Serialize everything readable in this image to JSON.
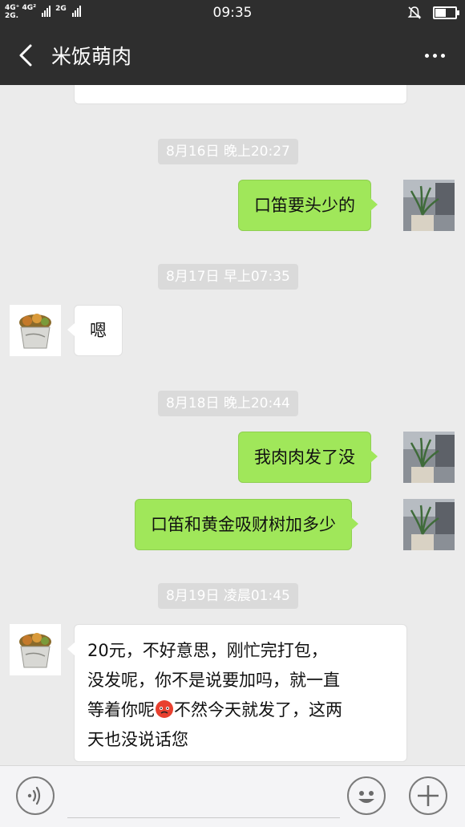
{
  "status_bar": {
    "network_top": "4G⁺ 4G²",
    "network_bottom": "2G.",
    "network_third": "2G",
    "time": "09:35",
    "battery_level": 0.6,
    "icons": [
      "signal-icon",
      "bell-mute-icon",
      "battery-icon"
    ]
  },
  "header": {
    "title": "米饭萌肉",
    "back_icon": "chevron-left-icon",
    "more_icon": "more-dots-icon"
  },
  "messages": [
    {
      "type": "timestamp",
      "text": "8月16日 晚上20:27"
    },
    {
      "type": "outgoing",
      "text": "口笛要头少的"
    },
    {
      "type": "timestamp",
      "text": "8月17日 早上07:35"
    },
    {
      "type": "incoming",
      "text": "嗯"
    },
    {
      "type": "timestamp",
      "text": "8月18日 晚上20:44"
    },
    {
      "type": "outgoing",
      "text": "我肉肉发了没"
    },
    {
      "type": "outgoing",
      "text": "口笛和黄金吸财树加多少"
    },
    {
      "type": "timestamp",
      "text": "8月19日 凌晨01:45"
    },
    {
      "type": "incoming",
      "lines": [
        "20元，不好意思，刚忙完打包，",
        "没发呢，你不是说要加吗，就一直",
        "等着你呢",
        "不然今天就发了，这两",
        "天也没说话您"
      ]
    }
  ],
  "input_bar": {
    "voice_icon": "voice-icon",
    "emoji_icon": "emoji-icon",
    "plus_icon": "plus-icon",
    "placeholder": ""
  },
  "colors": {
    "header_bg": "#2e2e2e",
    "chat_bg": "#ebebeb",
    "outgoing_bubble": "#a0e75a",
    "incoming_bubble": "#ffffff",
    "timestamp_bg": "#dadada"
  }
}
